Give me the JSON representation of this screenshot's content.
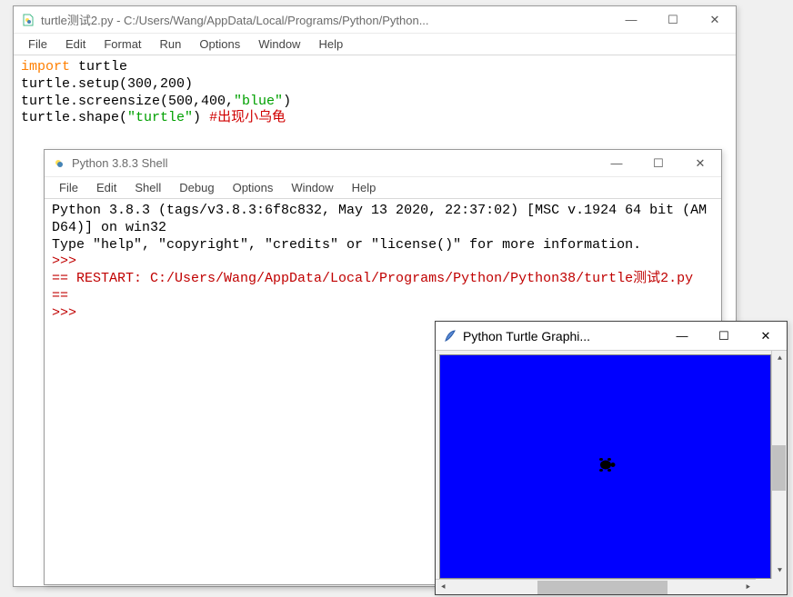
{
  "editor": {
    "title": "turtle测试2.py - C:/Users/Wang/AppData/Local/Programs/Python/Python...",
    "menus": [
      "File",
      "Edit",
      "Format",
      "Run",
      "Options",
      "Window",
      "Help"
    ],
    "code": {
      "l1_a": "import",
      "l1_b": " turtle",
      "l2": "turtle.setup(300,200)",
      "l3_a": "turtle.screensize(500,400,",
      "l3_b": "\"blue\"",
      "l3_c": ")",
      "l4_a": "turtle.shape(",
      "l4_b": "\"turtle\"",
      "l4_c": ") ",
      "l4_d": "#出现小乌龟"
    }
  },
  "shell": {
    "title": "Python 3.8.3 Shell",
    "menus": [
      "File",
      "Edit",
      "Shell",
      "Debug",
      "Options",
      "Window",
      "Help"
    ],
    "lines": {
      "l1": "Python 3.8.3 (tags/v3.8.3:6f8c832, May 13 2020, 22:37:02) [MSC v.1924 64 bit (AM",
      "l2": "D64)] on win32",
      "l3": "Type \"help\", \"copyright\", \"credits\" or \"license()\" for more information.",
      "p1": ">>> ",
      "r1": "== RESTART: C:/Users/Wang/AppData/Local/Programs/Python/Python38/turtle测试2.py ",
      "r2": "==",
      "p2": ">>> "
    }
  },
  "turtle": {
    "title": "Python Turtle Graphi...",
    "canvas_color": "#0000ff"
  },
  "winctl": {
    "min": "—",
    "max": "☐",
    "close": "✕"
  }
}
